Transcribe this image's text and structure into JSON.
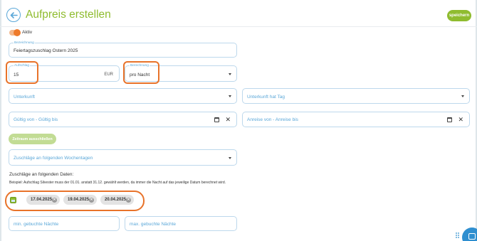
{
  "header": {
    "title": "Aufpreis erstellen",
    "save_label": "speichern"
  },
  "active_toggle": {
    "label": "Aktiv",
    "on": true
  },
  "fields": {
    "bezeichnung": {
      "label": "Bezeichnung",
      "value": "Feiertagszuschlag Ostern 2025"
    },
    "aufschlag": {
      "label": "Aufschlag",
      "value": "15",
      "unit": "EUR"
    },
    "berechnung": {
      "label": "Berechnung",
      "value": "pro Nacht"
    },
    "unterkunft": {
      "placeholder": "Unterkunft"
    },
    "unterkunft_hat_tag": {
      "placeholder": "Unterkunft hat Tag"
    },
    "gueltig": {
      "placeholder": "Gültig von - Gültig bis"
    },
    "anreise": {
      "placeholder": "Anreise von - Anreise bis"
    },
    "wochentage": {
      "placeholder": "Zuschläge an folgenden Wochentagen"
    },
    "min_naechte": {
      "placeholder": "min. gebuchte Nächte"
    },
    "max_naechte": {
      "placeholder": "max. gebuchte Nächte"
    }
  },
  "zeitraum_button": {
    "label": "Zeitraum ausschließen"
  },
  "dates_section": {
    "title": "Zuschläge an folgenden Daten:",
    "hint": "Beispiel: Aufschlag Silvester muss der 01.01. anstatt 31.12. gewählt werden, da immer die Nacht auf das jeweilige Datum berechnet wird.",
    "chips": [
      "17.04.2025",
      "19.04.2025",
      "20.04.2025"
    ]
  },
  "colors": {
    "accent_green": "#8fbc2f",
    "field_blue": "#5aa7d8",
    "highlight_orange": "#e8732a",
    "toggle_orange": "#ee7a2a"
  }
}
